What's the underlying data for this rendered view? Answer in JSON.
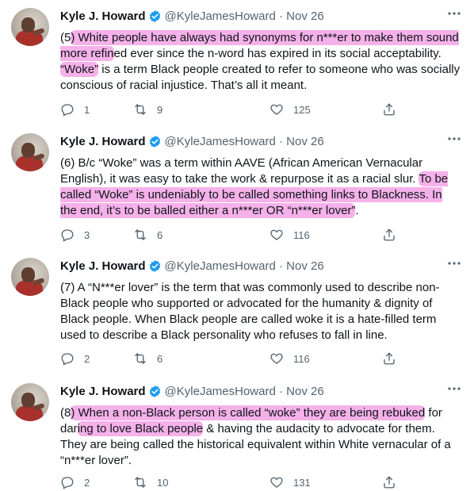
{
  "tweets": [
    {
      "name": "Kyle J. Howard",
      "handle": "@KyleJamesHoward · Nov 26",
      "text_parts": [
        {
          "t": "(5",
          "hl": false
        },
        {
          "t": ") White people have always had synonyms for n***er to make them sound more refin",
          "hl": true
        },
        {
          "t": "ed ever since the n-word has expired in its social acceptability. ",
          "hl": false
        },
        {
          "t": "“Woke”",
          "hl": true
        },
        {
          "t": " is a term Black people created to refer to someone who was socially conscious of racial injustice. That’s all it meant.",
          "hl": false
        }
      ],
      "replies": "1",
      "retweets": "9",
      "likes": "125"
    },
    {
      "name": "Kyle J. Howard",
      "handle": "@KyleJamesHoward · Nov 26",
      "text_parts": [
        {
          "t": "(6) B/c “Woke” was a term within AAVE (African American Vernacular English), it was easy to take the work & repurpose it as a racial slur. ",
          "hl": false
        },
        {
          "t": "To be called “Woke” is undeniably to be called something links to Blackness. In the end, it’s to be balled either a n***er OR “n***er lover”",
          "hl": true
        },
        {
          "t": ".",
          "hl": false
        }
      ],
      "replies": "3",
      "retweets": "6",
      "likes": "116"
    },
    {
      "name": "Kyle J. Howard",
      "handle": "@KyleJamesHoward · Nov 26",
      "text_parts": [
        {
          "t": "(7) A “N***er lover” is the term that was commonly used to describe non-Black people who supported or advocated for the humanity & dignity of Black people. When Black people are called woke it is a hate-filled term used to describe a Black personality who refuses to fall in line.",
          "hl": false
        }
      ],
      "replies": "2",
      "retweets": "6",
      "likes": "116"
    },
    {
      "name": "Kyle J. Howard",
      "handle": "@KyleJamesHoward · Nov 26",
      "text_parts": [
        {
          "t": "(8",
          "hl": false
        },
        {
          "t": ") When a non-Black person is called “woke” they are being rebuked",
          "hl": true
        },
        {
          "t": " for dar",
          "hl": false
        },
        {
          "t": "ing to love Black people",
          "hl": true
        },
        {
          "t": " & having the audacity to advocate for them. They are being called the historical equivalent within White vernacular of a “n***er lover”.",
          "hl": false
        }
      ],
      "replies": "2",
      "retweets": "10",
      "likes": "131"
    }
  ],
  "icons": {
    "verified": "verified-badge-icon",
    "more": "more-options-icon",
    "reply": "reply-icon",
    "retweet": "retweet-icon",
    "like": "like-icon",
    "share": "share-icon"
  },
  "colors": {
    "verified": "#1d9bf0",
    "text": "#0f1419",
    "secondary": "#536471",
    "highlight": "#ec71d7"
  }
}
